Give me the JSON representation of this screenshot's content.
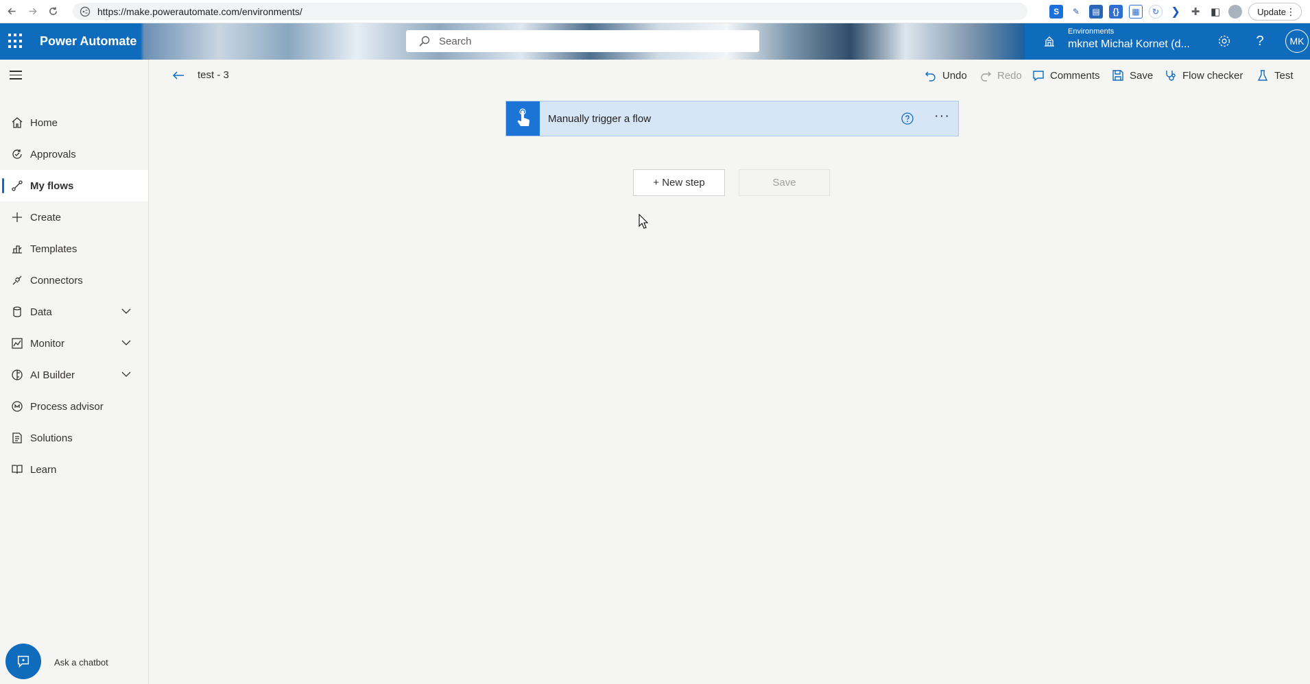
{
  "browser": {
    "url": "https://make.powerautomate.com/environments/",
    "update_label": "Update"
  },
  "header": {
    "app_name": "Power Automate",
    "search_placeholder": "Search",
    "environment_label": "Environments",
    "environment_name": "mknet Michał Kornet (d...",
    "avatar_initials": "MK"
  },
  "sidebar": {
    "items": [
      {
        "label": "Home",
        "icon": "home-icon"
      },
      {
        "label": "Approvals",
        "icon": "approvals-icon"
      },
      {
        "label": "My flows",
        "icon": "flows-icon",
        "active": true
      },
      {
        "label": "Create",
        "icon": "plus-icon"
      },
      {
        "label": "Templates",
        "icon": "templates-icon"
      },
      {
        "label": "Connectors",
        "icon": "connectors-icon"
      },
      {
        "label": "Data",
        "icon": "data-icon",
        "expandable": true
      },
      {
        "label": "Monitor",
        "icon": "monitor-icon",
        "expandable": true
      },
      {
        "label": "AI Builder",
        "icon": "ai-builder-icon",
        "expandable": true
      },
      {
        "label": "Process advisor",
        "icon": "process-advisor-icon"
      },
      {
        "label": "Solutions",
        "icon": "solutions-icon"
      },
      {
        "label": "Learn",
        "icon": "learn-icon"
      }
    ],
    "chatbot_label": "Ask a chatbot"
  },
  "command_bar": {
    "flow_title": "test - 3",
    "undo": "Undo",
    "redo": "Redo",
    "comments": "Comments",
    "save": "Save",
    "flow_checker": "Flow checker",
    "test": "Test"
  },
  "canvas": {
    "trigger_title": "Manually trigger a flow",
    "new_step_label": "+ New step",
    "save_label": "Save"
  },
  "colors": {
    "brand": "#0f6cbd",
    "trigger_card": "#d6e6f7"
  }
}
